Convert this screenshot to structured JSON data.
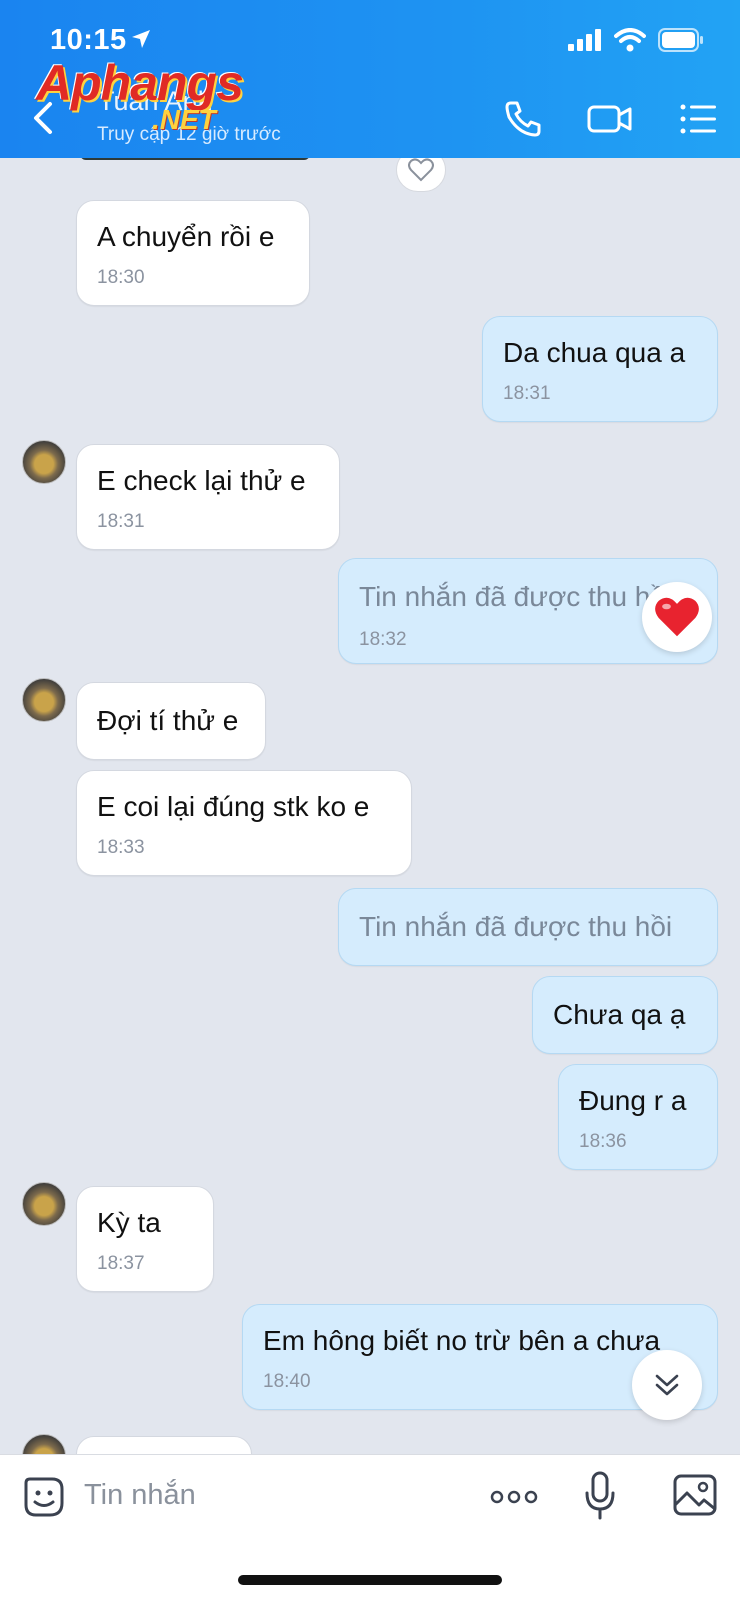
{
  "status_bar": {
    "time": "10:15"
  },
  "watermark": {
    "brand": "Aphangs",
    "suffix": ".NET"
  },
  "header": {
    "contact_name": "Tuấn Anh",
    "contact_status": "Truy cập 12 giờ trước"
  },
  "messages": [
    {
      "direction": "in",
      "text": "A chuyển rồi e",
      "time": "18:30"
    },
    {
      "direction": "out",
      "text": "Da chua qua a",
      "time": "18:31"
    },
    {
      "direction": "in",
      "text": "E check lại thử e",
      "time": "18:31"
    },
    {
      "direction": "out",
      "text": "Tin nhắn đã được thu hồi",
      "time": "18:32",
      "reaction": "heart"
    },
    {
      "direction": "in",
      "text": "Đợi tí thử e",
      "time": ""
    },
    {
      "direction": "in",
      "text": "E coi lại đúng stk ko e",
      "time": "18:33"
    },
    {
      "direction": "out",
      "text": "Tin nhắn đã được thu hồi",
      "time": ""
    },
    {
      "direction": "out",
      "text": "Chưa qa ạ",
      "time": ""
    },
    {
      "direction": "out",
      "text": "Đung r a",
      "time": "18:36"
    },
    {
      "direction": "in",
      "text": "Kỳ ta",
      "time": "18:37"
    },
    {
      "direction": "out",
      "text": "Em hông biết no trừ bên a chưa",
      "time": "18:40"
    }
  ],
  "input": {
    "placeholder": "Tin nhắn"
  },
  "colors": {
    "header": "#1e93f2",
    "outgoing_bubble": "#d5ecfd",
    "incoming_bubble": "#ffffff",
    "background": "#e2e6ee",
    "reaction_heart": "#e8232f"
  }
}
